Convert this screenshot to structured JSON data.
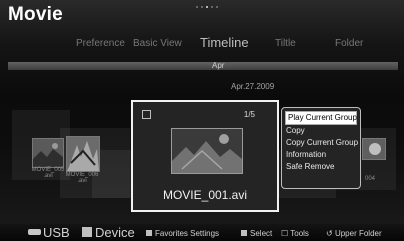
{
  "app": {
    "title": "Movie"
  },
  "pager": {
    "total": 5,
    "active_index": 2
  },
  "tabs": [
    {
      "label": "Preference",
      "active": false
    },
    {
      "label": "Basic View",
      "active": false
    },
    {
      "label": "Timeline",
      "active": true
    },
    {
      "label": "Tiltle",
      "active": false
    },
    {
      "label": "Folder",
      "active": false
    }
  ],
  "timeline": {
    "marker": "Apr",
    "date": "Apr.27.2009"
  },
  "thumbs": {
    "left1": "MOVIE_005\n.avi",
    "left2": "MOVIE_006\n.avi",
    "right": "004"
  },
  "focus": {
    "count": "1/5",
    "filename": "MOVIE_001.avi"
  },
  "menu": {
    "items": [
      "Play Current Group",
      "Copy",
      "Copy Current Group",
      "Information",
      "Safe Remove"
    ],
    "selected_index": 0
  },
  "bottom": {
    "usb": "USB",
    "device": "Device",
    "favorites": "Favorites Settings",
    "select": "Select",
    "tools": "Tools",
    "upper": "Upper Folder"
  },
  "colors": {
    "focus_border": "#f2f2f2",
    "menu_selected_bg": "#ffffff"
  },
  "icons": {
    "usb": "usb-icon",
    "tools": "tools-icon",
    "return": "return-icon"
  }
}
